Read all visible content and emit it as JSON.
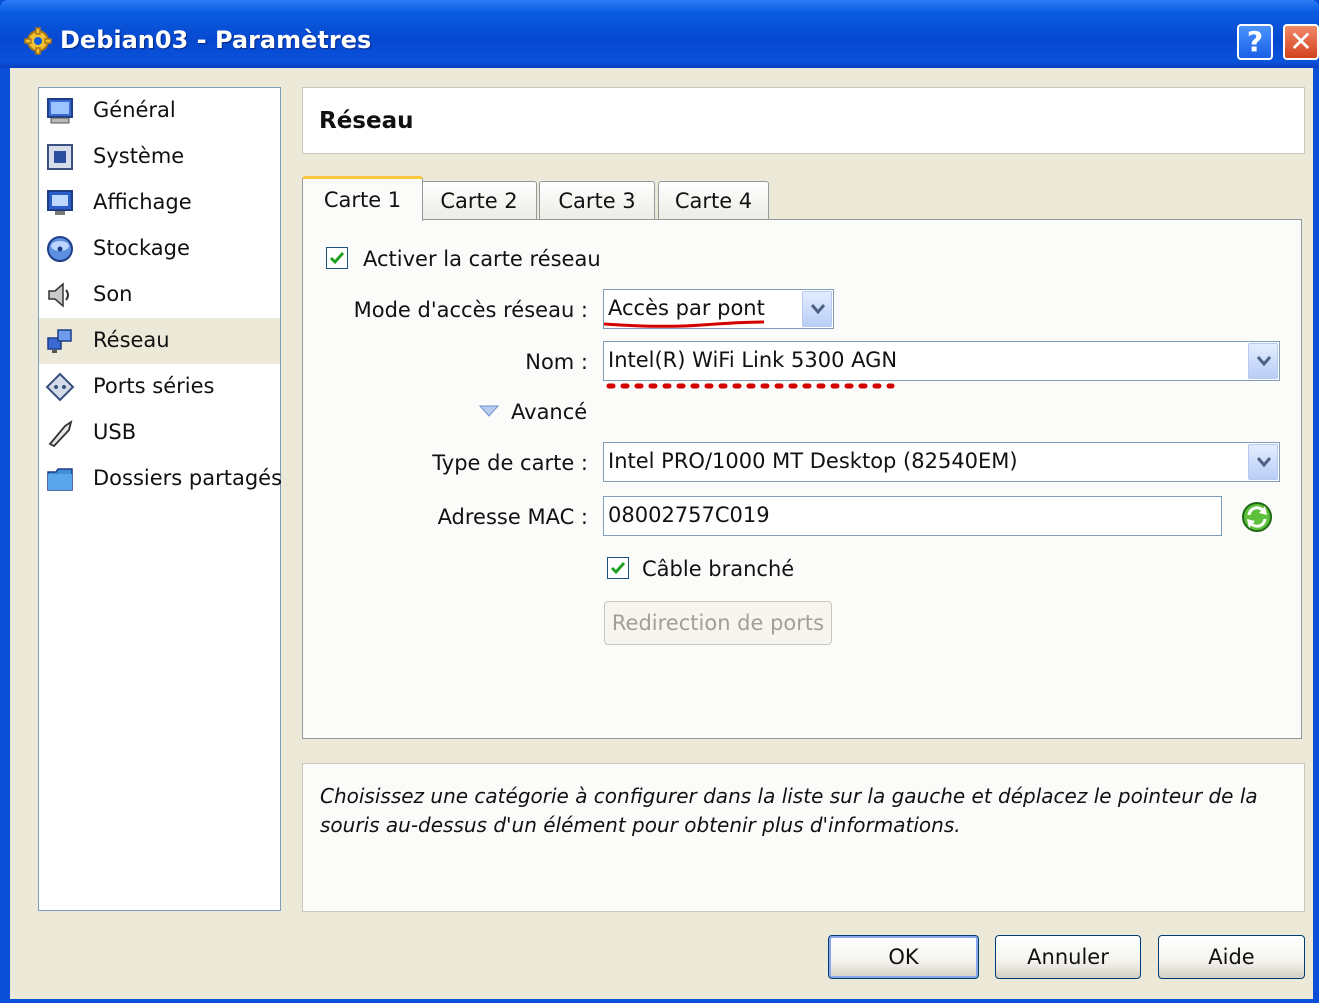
{
  "window": {
    "title": "Debian03 - Paramètres",
    "help_glyph": "?",
    "close_glyph": "✕"
  },
  "sidebar": {
    "items": [
      {
        "label": "Général",
        "icon": "monitor-icon"
      },
      {
        "label": "Système",
        "icon": "chip-icon"
      },
      {
        "label": "Affichage",
        "icon": "display-icon"
      },
      {
        "label": "Stockage",
        "icon": "disk-icon"
      },
      {
        "label": "Son",
        "icon": "speaker-icon"
      },
      {
        "label": "Réseau",
        "icon": "network-icon"
      },
      {
        "label": "Ports séries",
        "icon": "serial-port-icon"
      },
      {
        "label": "USB",
        "icon": "usb-icon"
      },
      {
        "label": "Dossiers partagés",
        "icon": "folder-icon"
      }
    ],
    "selected": "Réseau"
  },
  "header": {
    "title": "Réseau"
  },
  "tabs": [
    {
      "label": "Carte 1"
    },
    {
      "label": "Carte 2"
    },
    {
      "label": "Carte 3"
    },
    {
      "label": "Carte 4"
    }
  ],
  "form": {
    "enable_label": "Activer la carte réseau",
    "mode_label": "Mode d'accès réseau :",
    "mode_value": "Accès par pont",
    "name_label": "Nom :",
    "name_value": "Intel(R) WiFi Link 5300 AGN",
    "advanced_label": "Avancé",
    "card_type_label": "Type de carte :",
    "card_type_value": "Intel PRO/1000 MT Desktop (82540EM)",
    "mac_label": "Adresse MAC :",
    "mac_value": "08002757C019",
    "cable_label": "Câble branché",
    "port_forward_label": "Redirection de ports"
  },
  "info": {
    "text": "Choisissez une catégorie à configurer dans la liste sur la gauche et déplacez le pointeur de la souris au-dessus d'un élément pour obtenir plus d'informations."
  },
  "buttons": {
    "ok": "OK",
    "cancel": "Annuler",
    "help": "Aide"
  },
  "colors": {
    "title_bar": "#0a5ce0",
    "annotation_red": "#d40000",
    "tab_highlight": "#ffc83c"
  }
}
